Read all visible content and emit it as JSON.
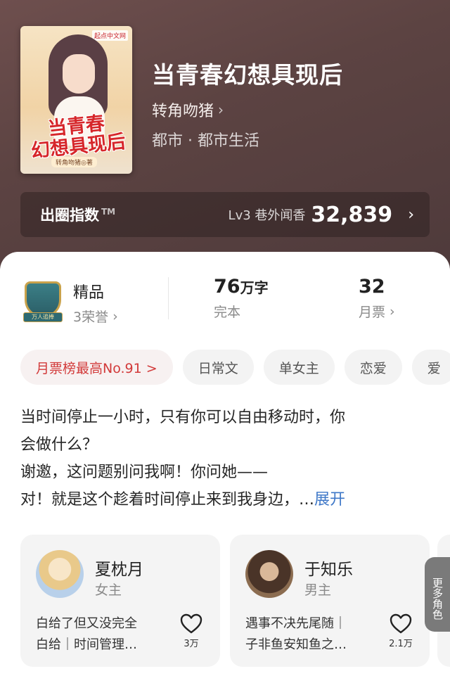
{
  "book": {
    "title": "当青春幻想具现后",
    "author": "转角吻猪",
    "category": "都市 · 都市生活",
    "cover_brand": "起点中文网",
    "cover_title_line1": "当青春",
    "cover_title_line2": "幻想具现后",
    "cover_author": "转角吻猪◎著"
  },
  "index": {
    "label": "出圈指数",
    "tm": "TM",
    "level": "Lv3 巷外闻香",
    "value": "32,839"
  },
  "stats": {
    "quality": "精品",
    "honors": "3荣誉",
    "badge_text": "万人追捧",
    "words_num": "76",
    "words_unit": "万字",
    "status": "完本",
    "tickets": "32",
    "tickets_label": "月票"
  },
  "tags": [
    "月票榜最高No.91 >",
    "日常文",
    "单女主",
    "恋爱",
    "爱"
  ],
  "description": {
    "line1": "当时间停止一小时，只有你可以自由移动时，你",
    "line2": "会做什么？",
    "line3": "谢邀，这问题别问我啊！你问她——",
    "line4": "对！就是这个趁着时间停止来到我身边，…",
    "expand": "展开"
  },
  "characters": [
    {
      "name": "夏枕月",
      "role": "女主",
      "desc1": "白给了但又没完全",
      "desc2": "白给｜时间管理…",
      "likes": "3万"
    },
    {
      "name": "于知乐",
      "role": "男主",
      "desc1": "遇事不决先尾随｜",
      "desc2": "子非鱼安知鱼之…",
      "likes": "2.1万"
    }
  ],
  "more_characters": "更多角色",
  "colors": {
    "accent_red": "#d23a3a",
    "link_blue": "#3f78c8",
    "hero_bg": "#5c4342"
  }
}
